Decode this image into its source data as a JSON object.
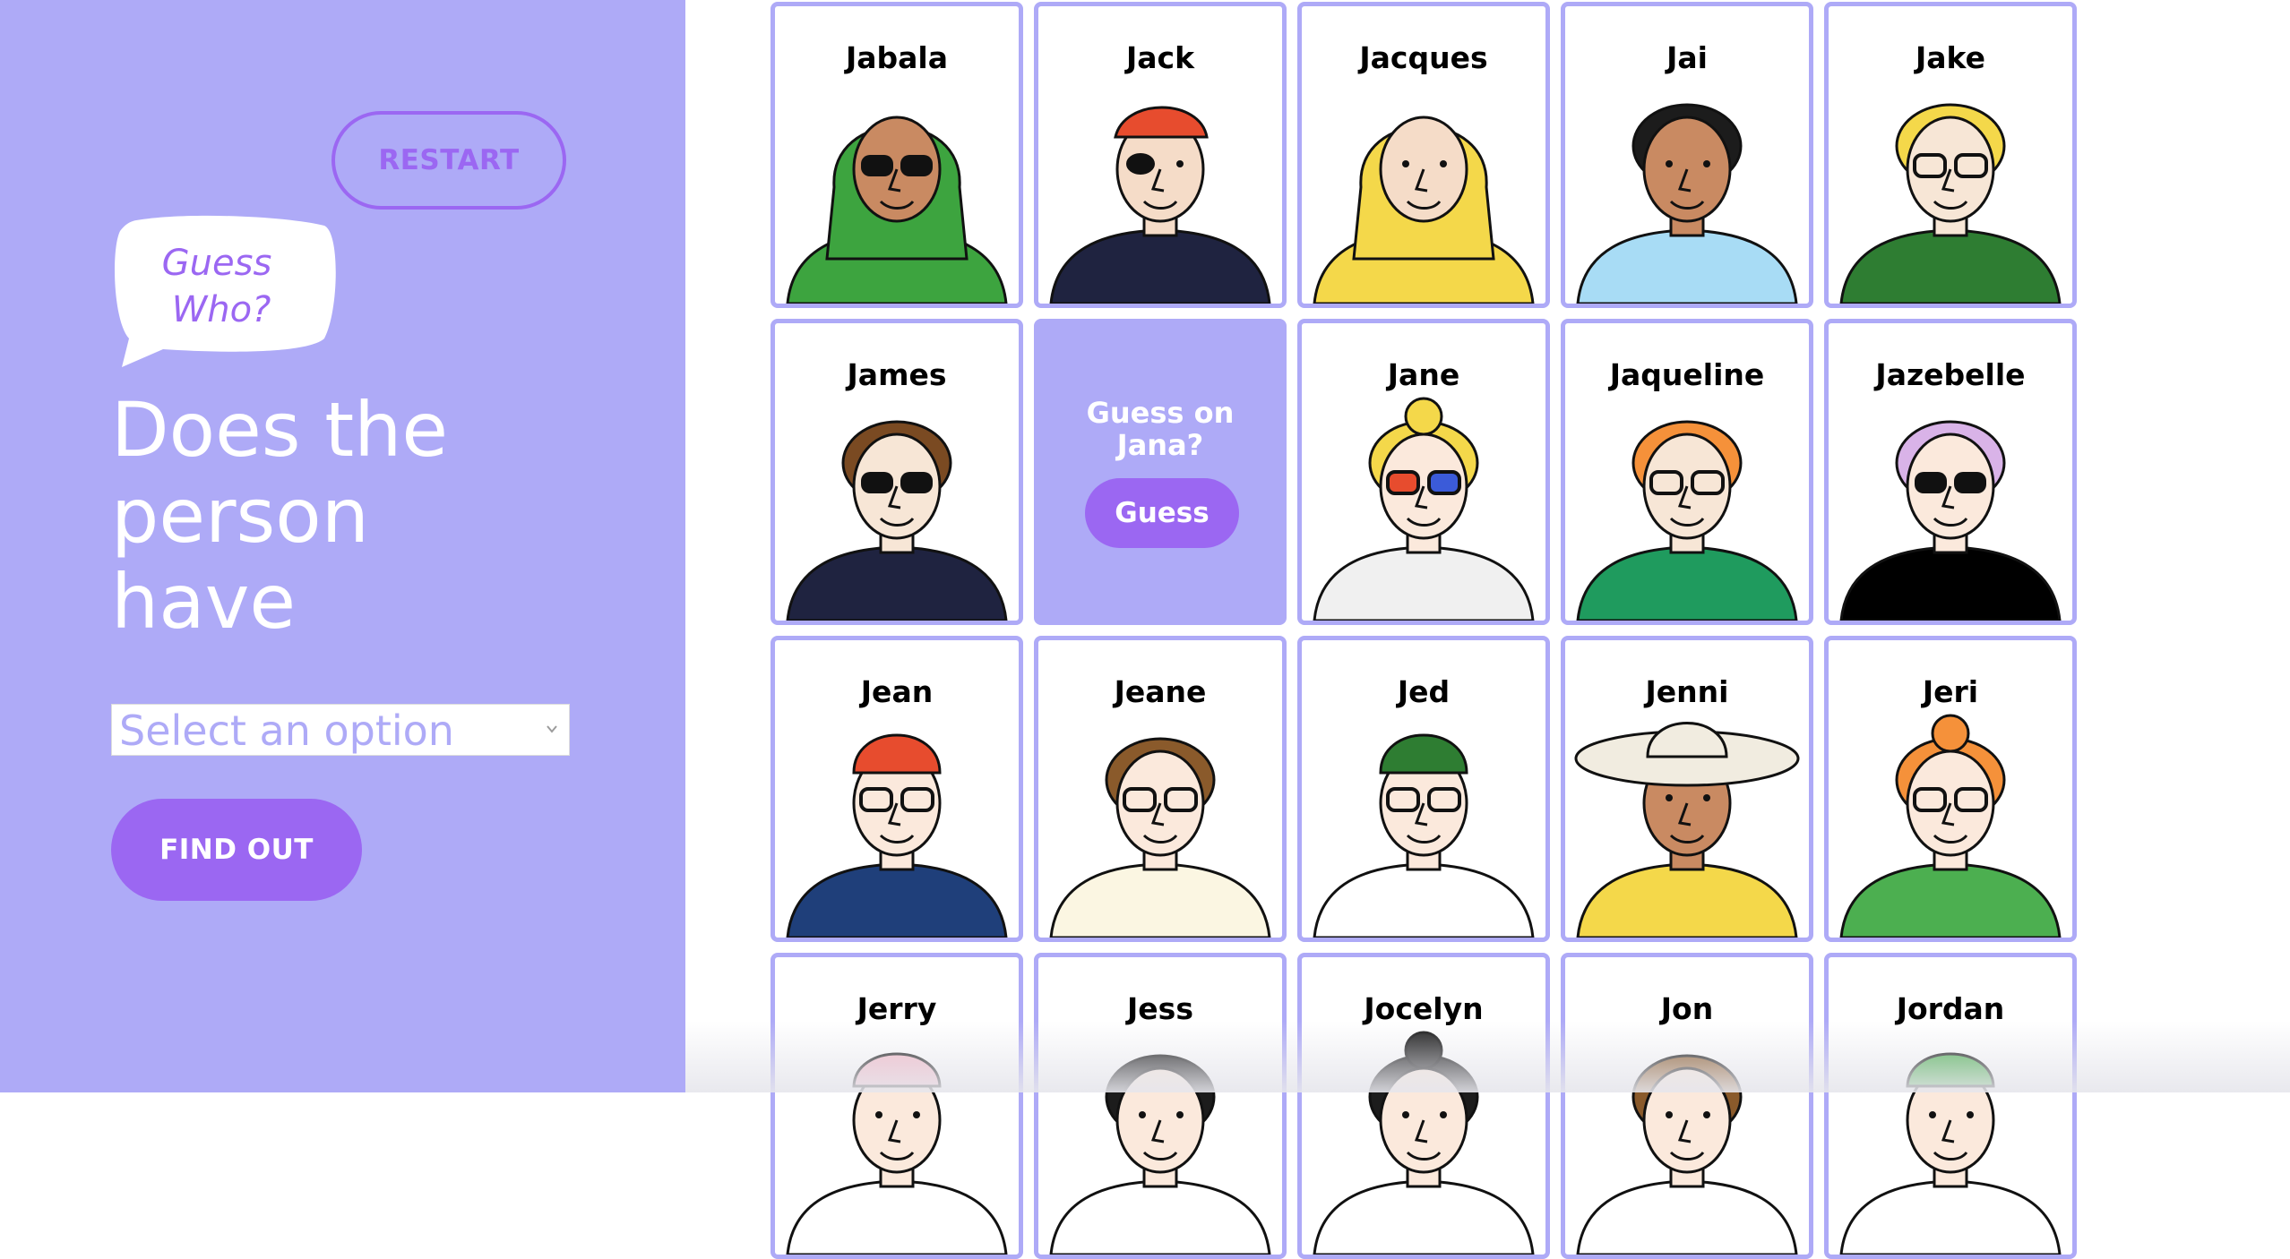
{
  "sidebar": {
    "restart_label": "RESTART",
    "bubble_line1": "Guess",
    "bubble_line2": "Who?",
    "question_line1": "Does the",
    "question_line2": "person",
    "question_line3": "have",
    "select_placeholder": "Select an option",
    "find_out_label": "FIND OUT"
  },
  "flipped_card": {
    "line1": "Guess on",
    "line2": "Jana?",
    "button_label": "Guess"
  },
  "characters": [
    {
      "name": "Jabala",
      "skin": "#c98a62",
      "hair": "#3da43f",
      "shirt": "#3da43f",
      "hat": "hijab",
      "glasses": "sun"
    },
    {
      "name": "Jack",
      "skin": "#f5dcc8",
      "hair": "#8a5a2b",
      "shirt": "#1f2340",
      "hat": "bandana",
      "glasses": "patch"
    },
    {
      "name": "Jacques",
      "skin": "#f5dcc8",
      "hair": "#dddddd",
      "shirt": "#f4d84a",
      "hat": "hood",
      "glasses": "none"
    },
    {
      "name": "Jai",
      "skin": "#c98a62",
      "hair": "#1c1c1c",
      "shirt": "#a8dcf5",
      "hat": "none",
      "glasses": "none"
    },
    {
      "name": "Jake",
      "skin": "#f7e6d6",
      "hair": "#f4d84a",
      "shirt": "#2e7d32",
      "hat": "none",
      "glasses": "clear"
    },
    {
      "name": "James",
      "skin": "#f7e6d6",
      "hair": "#7a4a22",
      "shirt": "#1f2340",
      "hat": "none",
      "glasses": "sun"
    },
    null,
    {
      "name": "Jane",
      "skin": "#fbe9dc",
      "hair": "#f4d84a",
      "shirt": "#f0f0f0",
      "hat": "bun",
      "glasses": "color"
    },
    {
      "name": "Jaqueline",
      "skin": "#f7e6d6",
      "hair": "#f5913a",
      "shirt": "#1f9b5e",
      "hat": "none",
      "glasses": "clear"
    },
    {
      "name": "Jazebelle",
      "skin": "#fbe9dc",
      "hair": "#d9b3e8",
      "shirt": "#000000",
      "hat": "none",
      "glasses": "sun"
    },
    {
      "name": "Jean",
      "skin": "#fbe9dc",
      "hair": "#e74c2e",
      "shirt": "#1f3f7a",
      "hat": "beanie",
      "glasses": "clear"
    },
    {
      "name": "Jeane",
      "skin": "#fbe9dc",
      "hair": "#8a5a2b",
      "shirt": "#fbf6e2",
      "hat": "none",
      "glasses": "clear"
    },
    {
      "name": "Jed",
      "skin": "#fbe9dc",
      "hair": "#f5913a",
      "shirt": "#ffffff",
      "hat": "beanie-green",
      "glasses": "clear"
    },
    {
      "name": "Jenni",
      "skin": "#c98a62",
      "hair": "#f1ece0",
      "shirt": "#f4d84a",
      "hat": "sunhat",
      "glasses": "none"
    },
    {
      "name": "Jeri",
      "skin": "#fbe9dc",
      "hair": "#f5913a",
      "shirt": "#4caf50",
      "hat": "bun",
      "glasses": "clear"
    },
    {
      "name": "Jerry",
      "skin": "#fbe9dc",
      "hair": "#f4b9c8",
      "shirt": "#ffffff",
      "hat": "cap",
      "glasses": "none"
    },
    {
      "name": "Jess",
      "skin": "#fbe9dc",
      "hair": "#1c1c1c",
      "shirt": "#ffffff",
      "hat": "none",
      "glasses": "none"
    },
    {
      "name": "Jocelyn",
      "skin": "#fbe9dc",
      "hair": "#1c1c1c",
      "shirt": "#ffffff",
      "hat": "bun",
      "glasses": "none"
    },
    {
      "name": "Jon",
      "skin": "#fbe9dc",
      "hair": "#8a5a2b",
      "shirt": "#ffffff",
      "hat": "none",
      "glasses": "none"
    },
    {
      "name": "Jordan",
      "skin": "#fbe9dc",
      "hair": "#f4d84a",
      "shirt": "#ffffff",
      "hat": "cap-green",
      "glasses": "none"
    }
  ],
  "colors": {
    "panel_bg": "#aeaaf7",
    "accent": "#9b67f2",
    "card_border": "#aeaaf7"
  }
}
